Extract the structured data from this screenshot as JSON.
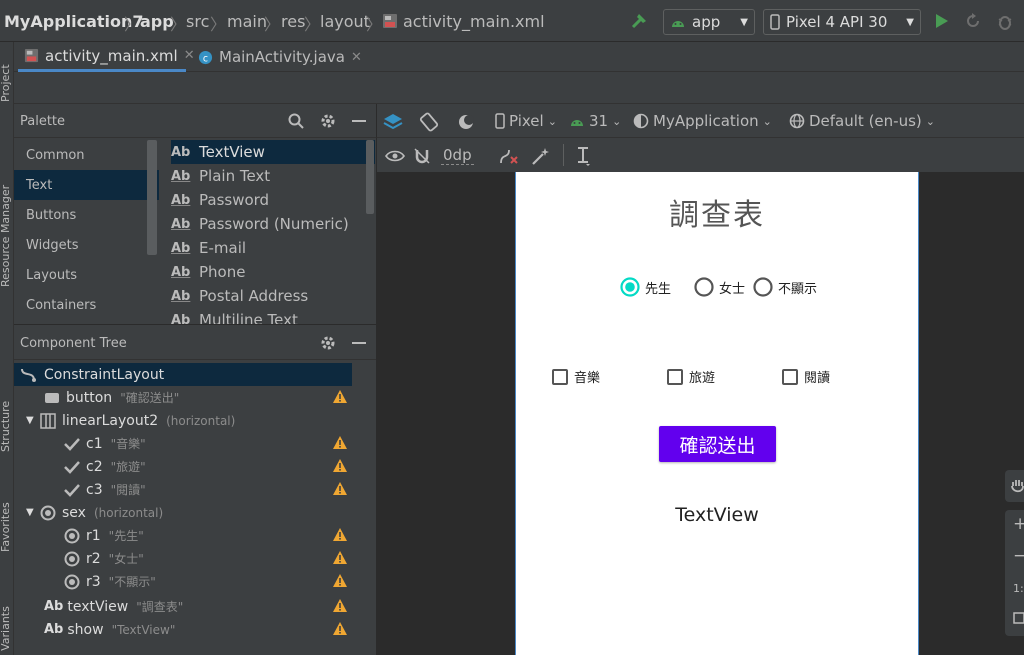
{
  "breadcrumb": {
    "project": "MyApplication7",
    "module": "app",
    "path": [
      "src",
      "main",
      "res",
      "layout"
    ],
    "file": "activity_main.xml"
  },
  "run_config": {
    "module": "app",
    "device": "Pixel 4 API 30"
  },
  "tabs": [
    {
      "label": "activity_main.xml",
      "active": true
    },
    {
      "label": "MainActivity.java",
      "active": false
    }
  ],
  "left_rail": [
    "Project",
    "Resource Manager",
    "Structure",
    "Favorites",
    "Build Variants"
  ],
  "palette": {
    "title": "Palette",
    "categories": [
      "Common",
      "Text",
      "Buttons",
      "Widgets",
      "Layouts",
      "Containers"
    ],
    "selected_category": "Text",
    "items": [
      "TextView",
      "Plain Text",
      "Password",
      "Password (Numeric)",
      "E-mail",
      "Phone",
      "Postal Address",
      "Multiline Text"
    ],
    "ab": "Ab"
  },
  "component_tree": {
    "title": "Component Tree",
    "nodes": [
      {
        "name": "ConstraintLayout",
        "sub": "",
        "icon": "constraint-icon"
      },
      {
        "name": "button",
        "sub": "\"確認送出\"",
        "icon": "button-icon"
      },
      {
        "name": "linearLayout2",
        "sub": "(horizontal)",
        "icon": "linear-layout-icon"
      },
      {
        "name": "c1",
        "sub": "\"音樂\"",
        "icon": "checkbox-icon"
      },
      {
        "name": "c2",
        "sub": "\"旅遊\"",
        "icon": "checkbox-icon"
      },
      {
        "name": "c3",
        "sub": "\"閱讀\"",
        "icon": "checkbox-icon"
      },
      {
        "name": "sex",
        "sub": "(horizontal)",
        "icon": "radio-group-icon"
      },
      {
        "name": "r1",
        "sub": "\"先生\"",
        "icon": "radio-icon"
      },
      {
        "name": "r2",
        "sub": "\"女士\"",
        "icon": "radio-icon"
      },
      {
        "name": "r3",
        "sub": "\"不顯示\"",
        "icon": "radio-icon"
      },
      {
        "name": "textView",
        "sub": "\"調查表\"",
        "icon": "textview-icon"
      },
      {
        "name": "show",
        "sub": "\"TextView\"",
        "icon": "textview-icon"
      }
    ]
  },
  "design_toolbar": {
    "device": "Pixel",
    "api": "31",
    "theme": "MyApplication",
    "locale": "Default (en-us)",
    "margin": "0dp"
  },
  "device_preview": {
    "title": "調查表",
    "radios": [
      "先生",
      "女士",
      "不顯示"
    ],
    "checkboxes": [
      "音樂",
      "旅遊",
      "閱讀"
    ],
    "button": "確認送出",
    "show": "TextView"
  },
  "colors": {
    "accent": "#4a88c7",
    "button": "#6200ee",
    "radio_checked": "#03dac5",
    "warning": "#f0a732",
    "run_green": "#499c54"
  }
}
